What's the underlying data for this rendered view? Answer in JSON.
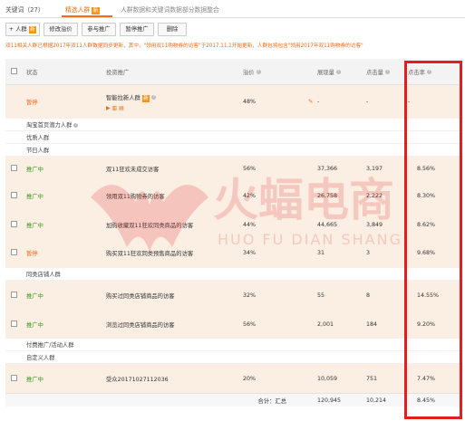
{
  "tabs": [
    {
      "label": "关键词（27）"
    },
    {
      "label": "精选人群",
      "badge": "新"
    },
    {
      "label": "人群数据和关键词数据部分数据整合"
    }
  ],
  "toolbar": {
    "add_label": "人群",
    "add_badge": "新",
    "edit_price_label": "修改溢价",
    "join_label": "参与推广",
    "pause_label": "暂停推广",
    "delete_label": "删除"
  },
  "notice": "双11相关人群已根据2017年双11人群数据同步更新，其中，\"领用双11购物券的访客\"于2017.11.1开始更新，人群包将包含\"领用2017年双11购物券的访客\"",
  "table": {
    "headers": {
      "status": "状态",
      "name": "投资推广",
      "premium": "溢价",
      "impressions": "展现量",
      "clicks": "点击量",
      "ctr": "点击率"
    },
    "smart_row": {
      "status": "暂停",
      "name": "智能拉新人群",
      "badge": "新",
      "premium": "48%",
      "impressions": "-",
      "clicks": "-",
      "ctr": "-"
    },
    "groups": {
      "g1": "淘宝首页潜力人群",
      "g2": "优质人群",
      "g3": "节日人群",
      "g4": "同类店铺人群",
      "g5": "付费推广/活动人群",
      "g6": "自定义人群"
    },
    "rows": [
      {
        "status": "推广中",
        "name": "双11狂欢未成交访客",
        "premium": "56%",
        "impressions": "37,366",
        "clicks": "3,197",
        "ctr": "8.56%"
      },
      {
        "status": "推广中",
        "name": "领用双11购物券的访客",
        "premium": "42%",
        "impressions": "26,758",
        "clicks": "2,222",
        "ctr": "8.30%"
      },
      {
        "status": "推广中",
        "name": "加购收藏双11狂欢同类商品的访客",
        "premium": "44%",
        "impressions": "44,665",
        "clicks": "3,849",
        "ctr": "8.62%"
      },
      {
        "status": "暂停",
        "name": "购买双11狂欢同类预售商品的访客",
        "premium": "34%",
        "impressions": "31",
        "clicks": "3",
        "ctr": "9.68%"
      },
      {
        "status": "推广中",
        "name": "购买过同类店铺商品的访客",
        "premium": "32%",
        "impressions": "55",
        "clicks": "8",
        "ctr": "14.55%"
      },
      {
        "status": "推广中",
        "name": "浏览过同类店铺商品的访客",
        "premium": "56%",
        "impressions": "2,001",
        "clicks": "184",
        "ctr": "9.20%"
      },
      {
        "status": "推广中",
        "name": "受众20171027112036",
        "premium": "20%",
        "impressions": "10,059",
        "clicks": "751",
        "ctr": "7.47%"
      }
    ],
    "total": {
      "label": "合计：汇总",
      "impressions": "120,945",
      "clicks": "10,214",
      "ctr": "8.45%"
    }
  },
  "watermark": {
    "cn": "火蝠电商",
    "en": "HUO FU DIAN SHANG"
  },
  "colors": {
    "accent": "#f26b15",
    "running": "#3a9a1a",
    "highlight_row": "#fbeee3",
    "red_box": "#e02020"
  }
}
